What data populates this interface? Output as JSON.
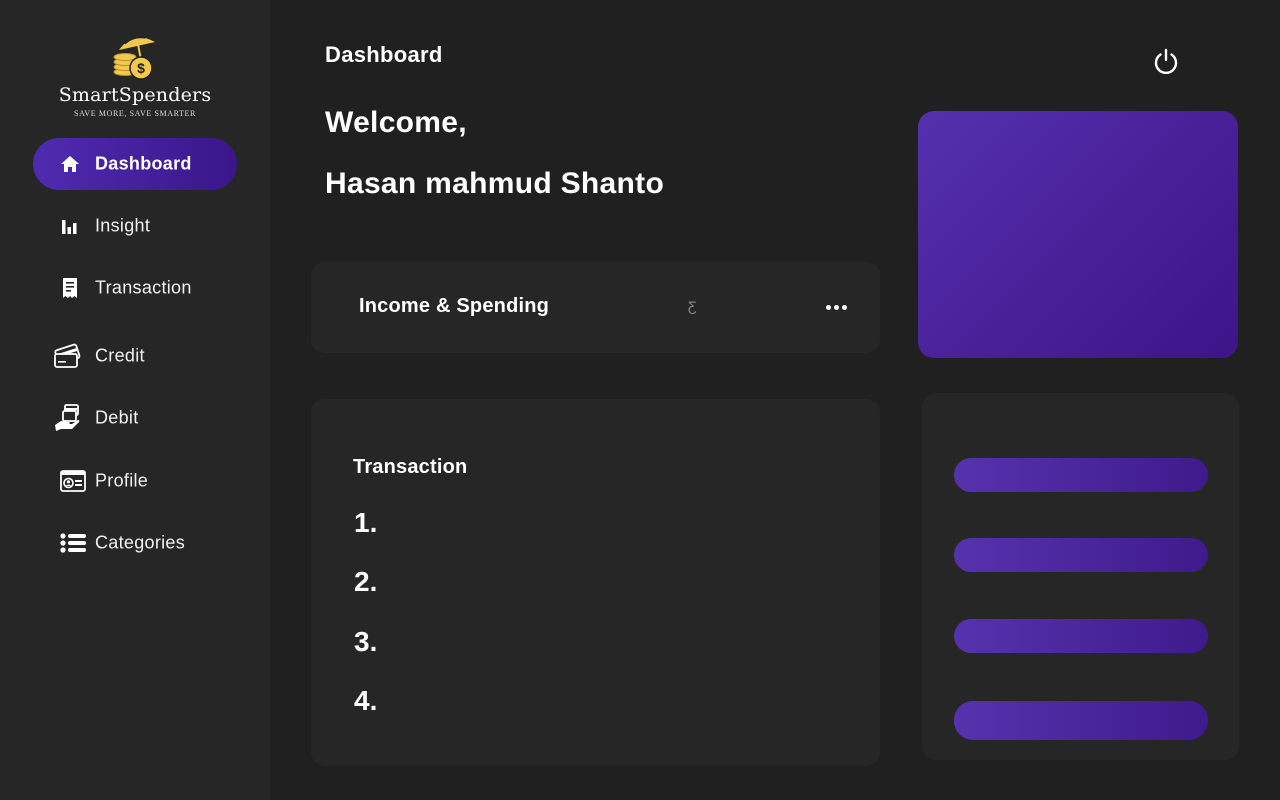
{
  "brand": {
    "name": "SmartSpenders",
    "tagline": "SAVE MORE, SAVE SMARTER",
    "logo_icon": "umbrella-coins-icon",
    "colors": {
      "gold": "#f2c94c",
      "accent": "#4f2bb0",
      "accent_dark": "#3a168a"
    }
  },
  "sidebar": {
    "items": [
      {
        "label": "Dashboard",
        "icon": "home-icon",
        "active": true
      },
      {
        "label": "Insight",
        "icon": "bar-chart-icon",
        "active": false
      },
      {
        "label": "Transaction",
        "icon": "receipt-icon",
        "active": false
      },
      {
        "label": "Credit",
        "icon": "credit-card-icon",
        "active": false
      },
      {
        "label": "Debit",
        "icon": "hand-card-icon",
        "active": false
      },
      {
        "label": "Profile",
        "icon": "id-card-icon",
        "active": false
      },
      {
        "label": "Categories",
        "icon": "list-icon",
        "active": false
      }
    ]
  },
  "header": {
    "title": "Dashboard",
    "power_icon": "power-icon"
  },
  "greeting": {
    "welcome": "Welcome,",
    "user_name": "Hasan mahmud Shanto"
  },
  "income_card": {
    "title": "Income & Spending",
    "glyph": "Ƹ",
    "more_icon": "more-horizontal-icon"
  },
  "transaction_card": {
    "title": "Transaction",
    "items": [
      "1.",
      "2.",
      "3.",
      "4."
    ]
  }
}
